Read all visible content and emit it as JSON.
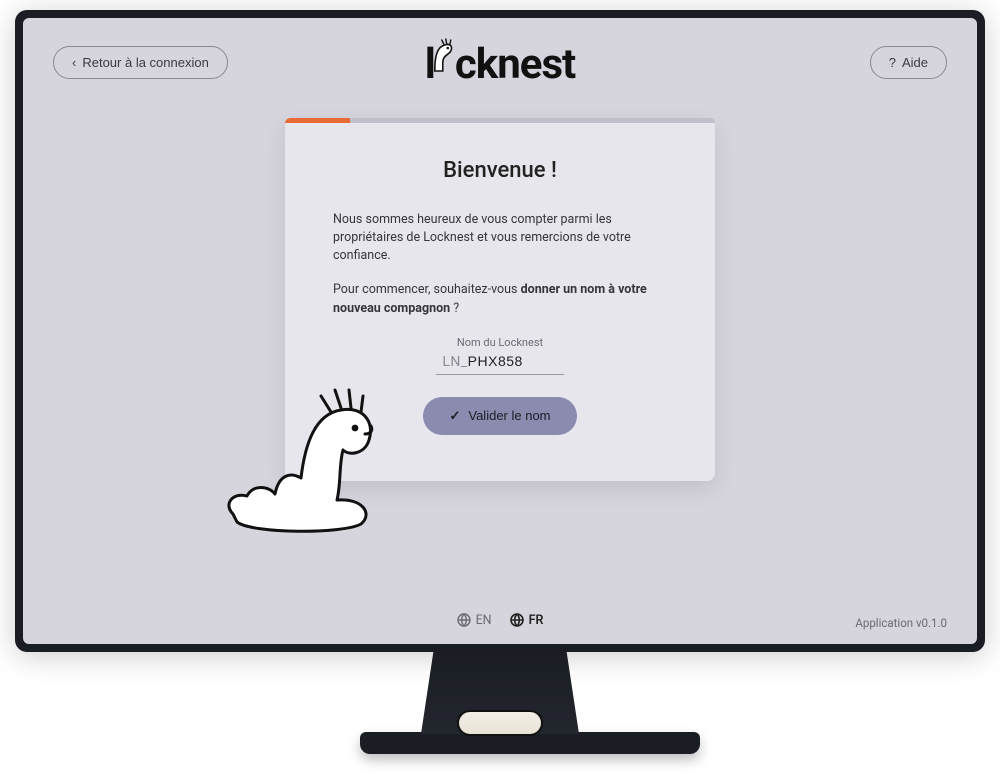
{
  "header": {
    "back_label": "Retour à la connexion",
    "help_label": "Aide",
    "brand": "locknest"
  },
  "welcome": {
    "title": "Bienvenue !",
    "para1": "Nous sommes heureux de vous compter parmi les propriétaires de Locknest et vous remercions de votre confiance.",
    "para2_a": "Pour commencer, souhaitez-vous ",
    "para2_b": "donner un nom à votre nouveau compagnon",
    "para2_c": " ?",
    "field_label": "Nom du Locknest",
    "field_prefix": "LN_",
    "field_value": "PHX858",
    "validate_label": "Valider le nom"
  },
  "footer": {
    "lang_en": "EN",
    "lang_fr": "FR",
    "version": "Application v0.1.0"
  }
}
